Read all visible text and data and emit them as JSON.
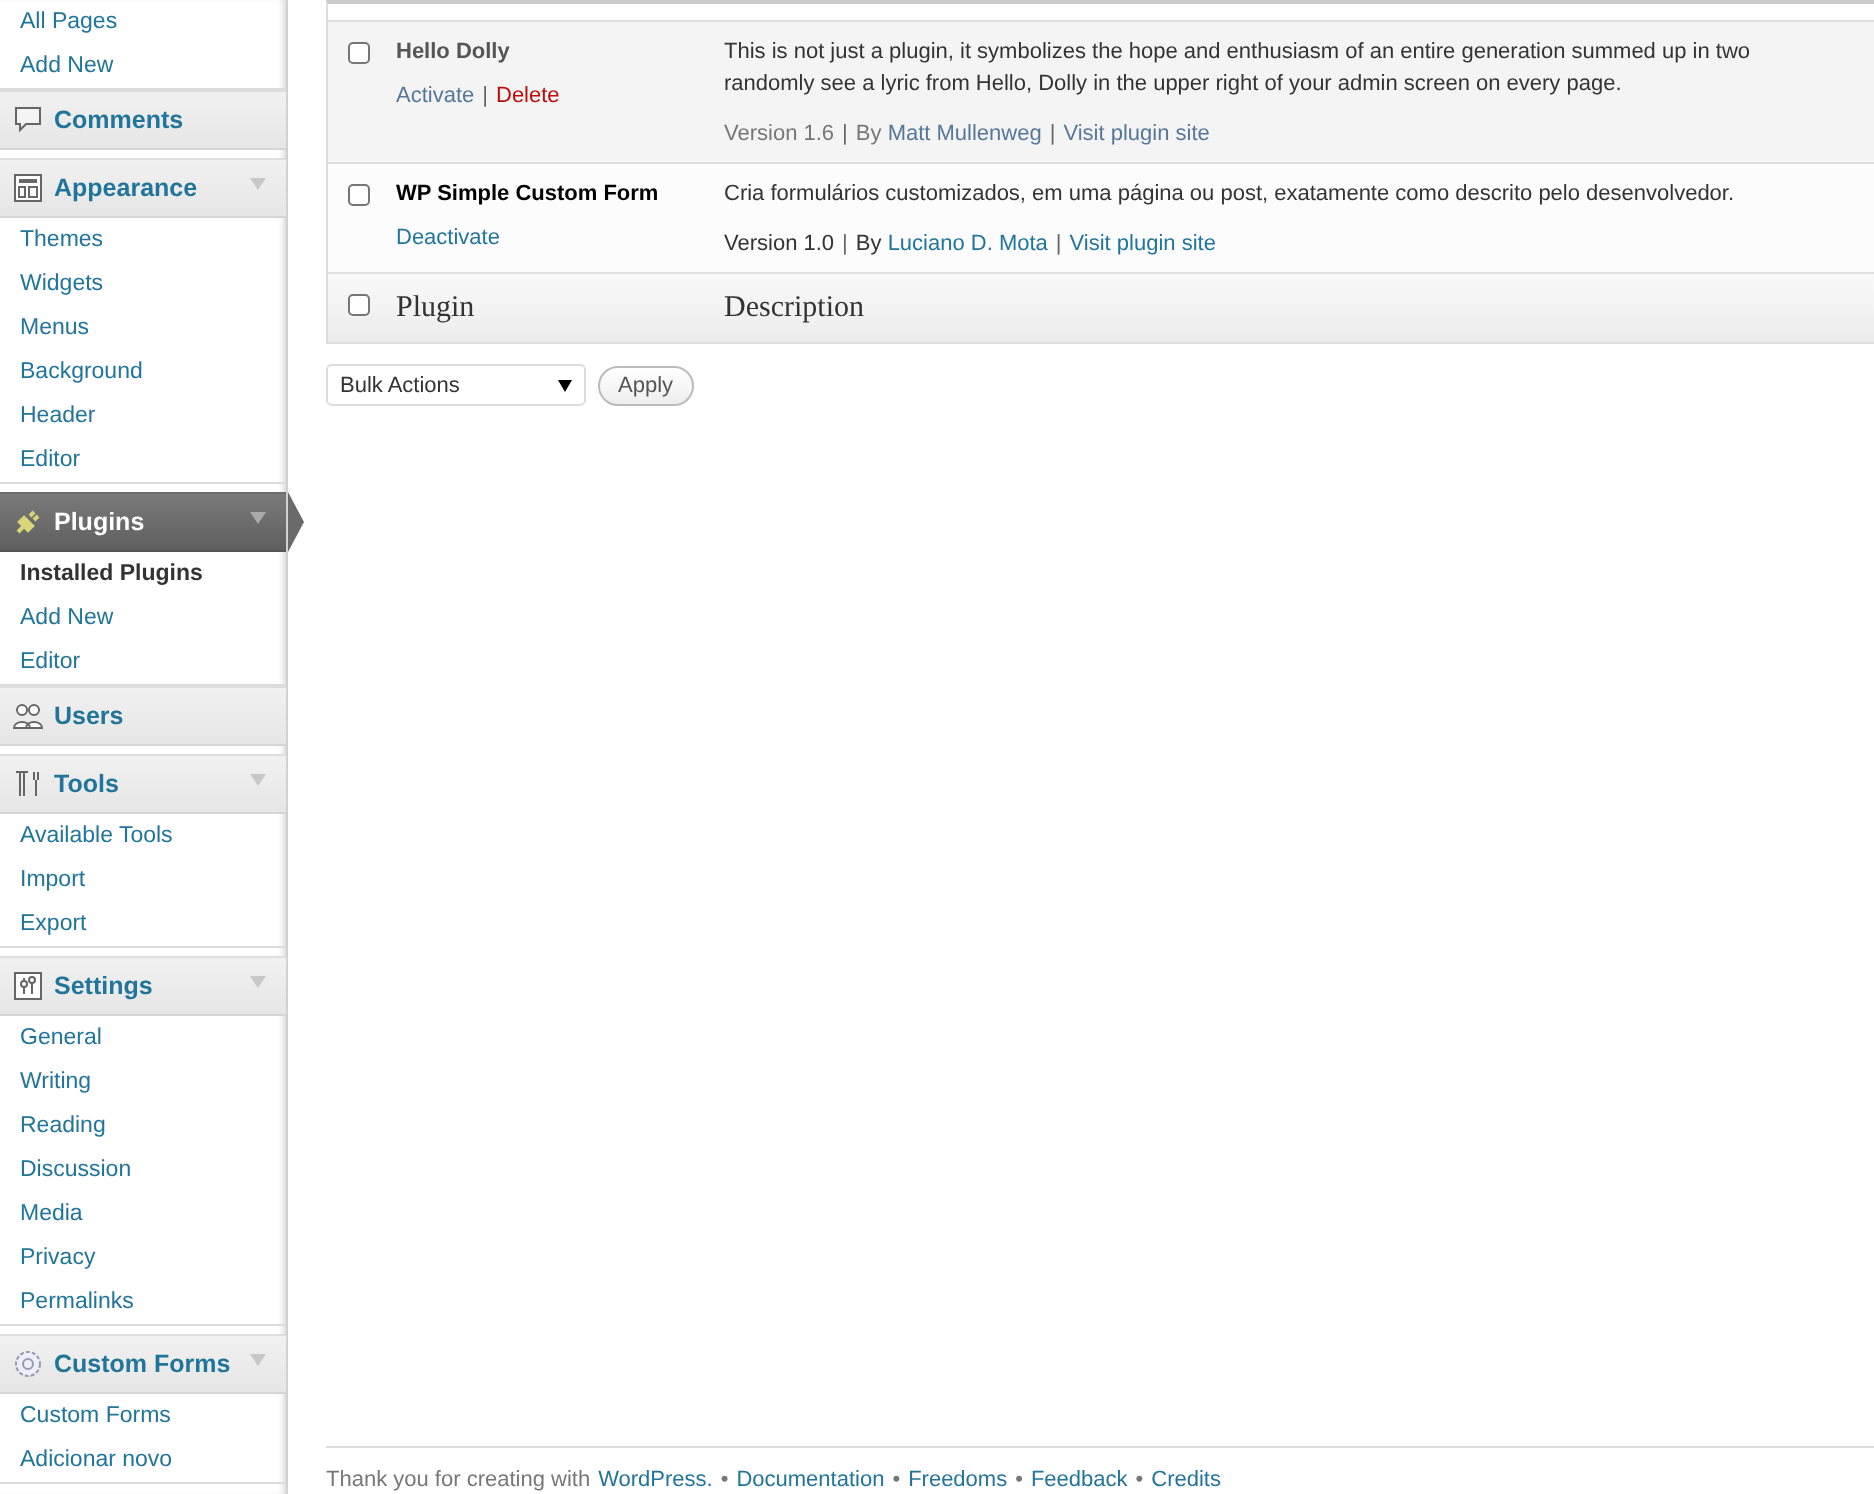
{
  "sidebar": {
    "top_items": [
      {
        "label": "All Pages",
        "selected": false
      },
      {
        "label": "Add New",
        "selected": false
      }
    ],
    "sections": [
      {
        "label": "Comments",
        "current": false,
        "expanded": false
      },
      {
        "label": "Appearance",
        "current": false,
        "expanded": true,
        "items": [
          {
            "label": "Themes",
            "selected": false
          },
          {
            "label": "Widgets",
            "selected": false
          },
          {
            "label": "Menus",
            "selected": false
          },
          {
            "label": "Background",
            "selected": false
          },
          {
            "label": "Header",
            "selected": false
          },
          {
            "label": "Editor",
            "selected": false
          }
        ]
      },
      {
        "label": "Plugins",
        "current": true,
        "expanded": true,
        "items": [
          {
            "label": "Installed Plugins",
            "selected": true
          },
          {
            "label": "Add New",
            "selected": false
          },
          {
            "label": "Editor",
            "selected": false
          }
        ]
      },
      {
        "label": "Users",
        "current": false,
        "expanded": false
      },
      {
        "label": "Tools",
        "current": false,
        "expanded": true,
        "items": [
          {
            "label": "Available Tools",
            "selected": false
          },
          {
            "label": "Import",
            "selected": false
          },
          {
            "label": "Export",
            "selected": false
          }
        ]
      },
      {
        "label": "Settings",
        "current": false,
        "expanded": true,
        "items": [
          {
            "label": "General",
            "selected": false
          },
          {
            "label": "Writing",
            "selected": false
          },
          {
            "label": "Reading",
            "selected": false
          },
          {
            "label": "Discussion",
            "selected": false
          },
          {
            "label": "Media",
            "selected": false
          },
          {
            "label": "Privacy",
            "selected": false
          },
          {
            "label": "Permalinks",
            "selected": false
          }
        ]
      },
      {
        "label": "Custom Forms",
        "current": false,
        "expanded": true,
        "items": [
          {
            "label": "Custom Forms",
            "selected": false
          },
          {
            "label": "Adicionar novo",
            "selected": false
          }
        ]
      }
    ]
  },
  "plugins": [
    {
      "name": "Hello Dolly",
      "active": false,
      "checked": false,
      "actions": [
        {
          "label": "Activate",
          "kind": "link"
        },
        {
          "label": "Delete",
          "kind": "delete"
        }
      ],
      "description_lines": [
        "This is not just a plugin, it symbolizes the hope and enthusiasm of an entire generation summed up in two",
        "randomly see a lyric from Hello, Dolly in the upper right of your admin screen on every page."
      ],
      "version": "Version 1.6",
      "by": "By",
      "author": "Matt Mullenweg",
      "site_link": "Visit plugin site"
    },
    {
      "name": "WP Simple Custom Form",
      "active": true,
      "checked": false,
      "actions": [
        {
          "label": "Deactivate",
          "kind": "link"
        }
      ],
      "description_lines": [
        "Cria formulários customizados, em uma página ou post, exatamente como descrito pelo desenvolvedor."
      ],
      "version": "Version 1.0",
      "by": "By",
      "author": "Luciano D. Mota",
      "site_link": "Visit plugin site"
    }
  ],
  "separator": "|",
  "table_footer": {
    "checked": false,
    "columns": [
      "Plugin",
      "Description"
    ]
  },
  "bulk_actions": {
    "value": "Bulk Actions",
    "button": "Apply"
  },
  "footer": {
    "text": "Thank you for creating with",
    "links": [
      "WordPress.",
      "Documentation",
      "Freedoms",
      "Feedback",
      "Credits"
    ],
    "bullet": "•"
  }
}
